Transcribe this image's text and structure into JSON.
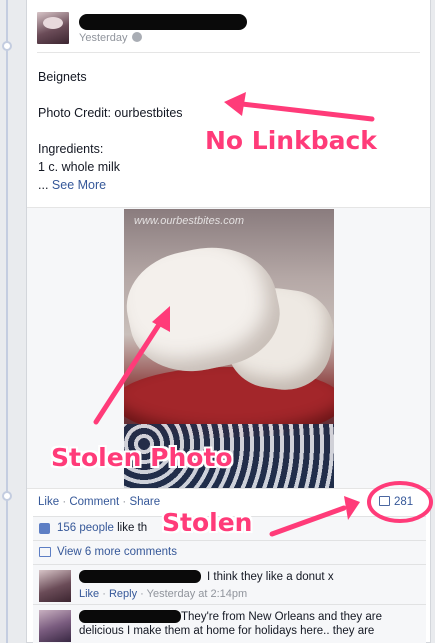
{
  "post": {
    "timestamp": "Yesterday",
    "text_lines": [
      "Beignets",
      "Photo Credit: ourbestbites",
      "Ingredients:",
      "1 c. whole milk"
    ],
    "see_more_prefix": "...",
    "see_more": "See More"
  },
  "photo": {
    "watermark": "www.ourbestbites.com"
  },
  "actions": {
    "like": "Like",
    "comment": "Comment",
    "share": "Share",
    "separator": "·",
    "comment_count": "281"
  },
  "likes": {
    "count_text": "156 people",
    "suffix": "like th"
  },
  "view_more": "View 6 more comments",
  "comments": [
    {
      "text": "I think they like a donut x",
      "like": "Like",
      "reply": "Reply",
      "time": "Yesterday at 2:14pm"
    },
    {
      "text": "They're from New Orleans and they are delicious I make them at home for holidays here.. they are"
    }
  ],
  "annotations": {
    "no_linkback": "No Linkback",
    "stolen_photo": "Stolen Photo",
    "stolen": "Stolen",
    "color": "#ff3b79"
  },
  "colors": {
    "link": "#365899",
    "background": "#e9ebee",
    "card": "#ffffff",
    "meta": "#90949c"
  }
}
